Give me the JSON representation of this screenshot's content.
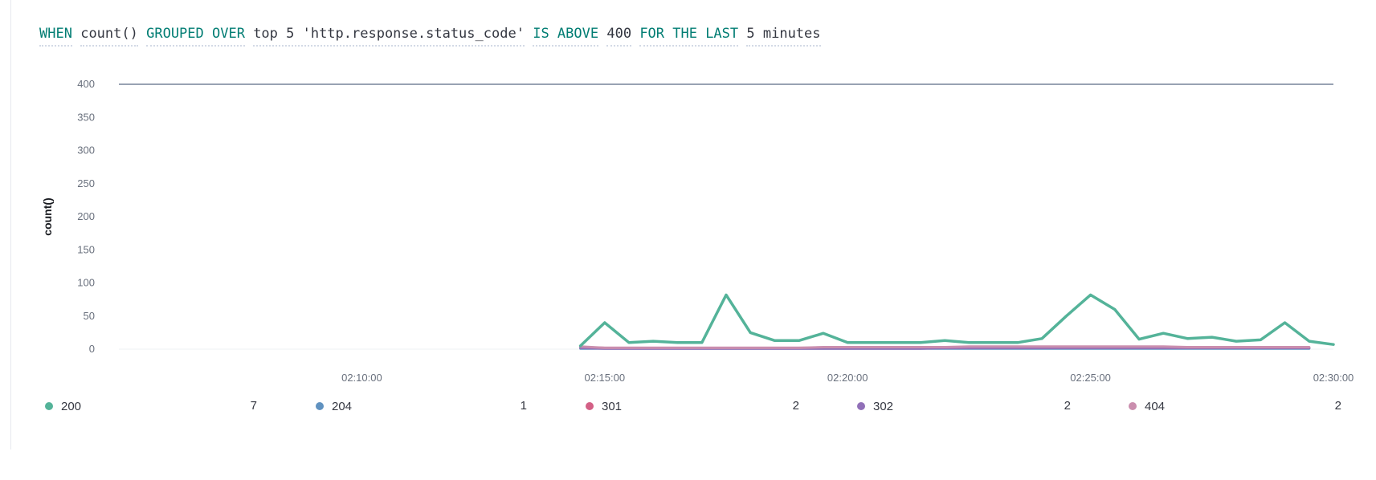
{
  "expression": {
    "when": "WHEN",
    "agg": "count()",
    "grouped_over": "GROUPED OVER",
    "group_term": "top 5 'http.response.status_code'",
    "is_above": "IS ABOVE",
    "threshold": "400",
    "for_the_last": "FOR THE LAST",
    "window": "5 minutes"
  },
  "chart_data": {
    "type": "line",
    "title": "",
    "xlabel": "",
    "ylabel": "count()",
    "ylim": [
      0,
      400
    ],
    "yticks": [
      "0",
      "50",
      "100",
      "150",
      "200",
      "250",
      "300",
      "350",
      "400"
    ],
    "xlim": [
      "02:05:00",
      "02:30:00"
    ],
    "xticks": [
      "02:10:00",
      "02:15:00",
      "02:20:00",
      "02:25:00",
      "02:30:00"
    ],
    "threshold": 400,
    "grid": false,
    "legend_position": "bottom",
    "x": [
      "02:14:30",
      "02:15:00",
      "02:15:30",
      "02:16:00",
      "02:16:30",
      "02:17:00",
      "02:17:30",
      "02:18:00",
      "02:18:30",
      "02:19:00",
      "02:19:30",
      "02:20:00",
      "02:20:30",
      "02:21:00",
      "02:21:30",
      "02:22:00",
      "02:22:30",
      "02:23:00",
      "02:23:30",
      "02:24:00",
      "02:24:30",
      "02:25:00",
      "02:25:30",
      "02:26:00",
      "02:26:30",
      "02:27:00",
      "02:27:30",
      "02:28:00",
      "02:28:30",
      "02:29:00",
      "02:29:30",
      "02:30:00"
    ],
    "series": [
      {
        "name": "200",
        "color": "#54b399",
        "legend_value": "7",
        "values": [
          5,
          40,
          10,
          12,
          10,
          10,
          82,
          25,
          13,
          13,
          24,
          10,
          10,
          10,
          10,
          13,
          10,
          10,
          10,
          16,
          50,
          82,
          60,
          15,
          24,
          16,
          18,
          12,
          14,
          40,
          12,
          7
        ]
      },
      {
        "name": "204",
        "color": "#6092c0",
        "legend_value": "1",
        "values": [
          1,
          1,
          1,
          1,
          1,
          1,
          1,
          1,
          1,
          1,
          1,
          1,
          1,
          1,
          1,
          1,
          1,
          1,
          1,
          1,
          1,
          1,
          1,
          1,
          1,
          1,
          1,
          1,
          1,
          1,
          1,
          null
        ]
      },
      {
        "name": "301",
        "color": "#d36086",
        "legend_value": "2",
        "values": [
          3,
          2,
          2,
          2,
          2,
          2,
          2,
          2,
          2,
          2,
          2,
          2,
          2,
          2,
          2,
          2,
          2,
          2,
          2,
          2,
          2,
          2,
          2,
          2,
          2,
          2,
          2,
          2,
          2,
          2,
          2,
          null
        ]
      },
      {
        "name": "302",
        "color": "#9170b8",
        "legend_value": "2",
        "values": [
          2,
          1,
          1,
          1,
          1,
          1,
          1,
          1,
          1,
          1,
          1,
          1,
          1,
          1,
          1,
          2,
          2,
          2,
          2,
          2,
          2,
          2,
          2,
          2,
          2,
          2,
          2,
          2,
          2,
          2,
          2,
          null
        ]
      },
      {
        "name": "404",
        "color": "#ca8eae",
        "legend_value": "2",
        "values": [
          4,
          2,
          2,
          2,
          2,
          2,
          2,
          2,
          2,
          2,
          3,
          3,
          3,
          3,
          3,
          3,
          4,
          4,
          4,
          4,
          4,
          4,
          4,
          4,
          4,
          3,
          3,
          3,
          3,
          3,
          3,
          null
        ]
      }
    ]
  }
}
